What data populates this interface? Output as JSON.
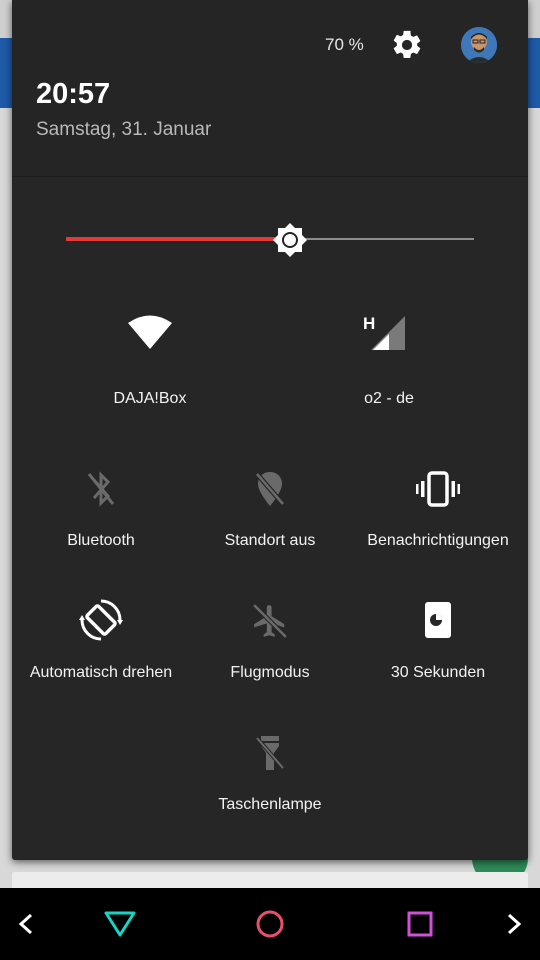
{
  "status": {
    "battery": "70 %"
  },
  "header": {
    "time": "20:57",
    "date": "Samstag, 31. Januar"
  },
  "brightness": {
    "level_percent": 55
  },
  "tiles": {
    "wifi": {
      "label": "DAJA!Box",
      "icon": "wifi-icon"
    },
    "cellular": {
      "label": "o2 - de",
      "network_type": "H",
      "icon": "cellular-signal-icon"
    },
    "bluetooth": {
      "label": "Bluetooth",
      "icon": "bluetooth-disabled-icon"
    },
    "location": {
      "label": "Standort aus",
      "icon": "location-off-icon"
    },
    "notifications": {
      "label": "Benachrichtigungen",
      "icon": "vibrate-icon"
    },
    "rotate": {
      "label": "Automatisch drehen",
      "icon": "auto-rotate-icon"
    },
    "airplane": {
      "label": "Flugmodus",
      "icon": "airplane-icon"
    },
    "screen_timeout": {
      "label": "30 Sekunden",
      "icon": "screen-timeout-icon"
    },
    "flashlight": {
      "label": "Taschenlampe",
      "icon": "flashlight-icon"
    }
  },
  "colors": {
    "slider_active": "#e53935",
    "nav_back": "#19d3c5",
    "nav_home": "#e8506a",
    "nav_recents": "#d050d8"
  }
}
